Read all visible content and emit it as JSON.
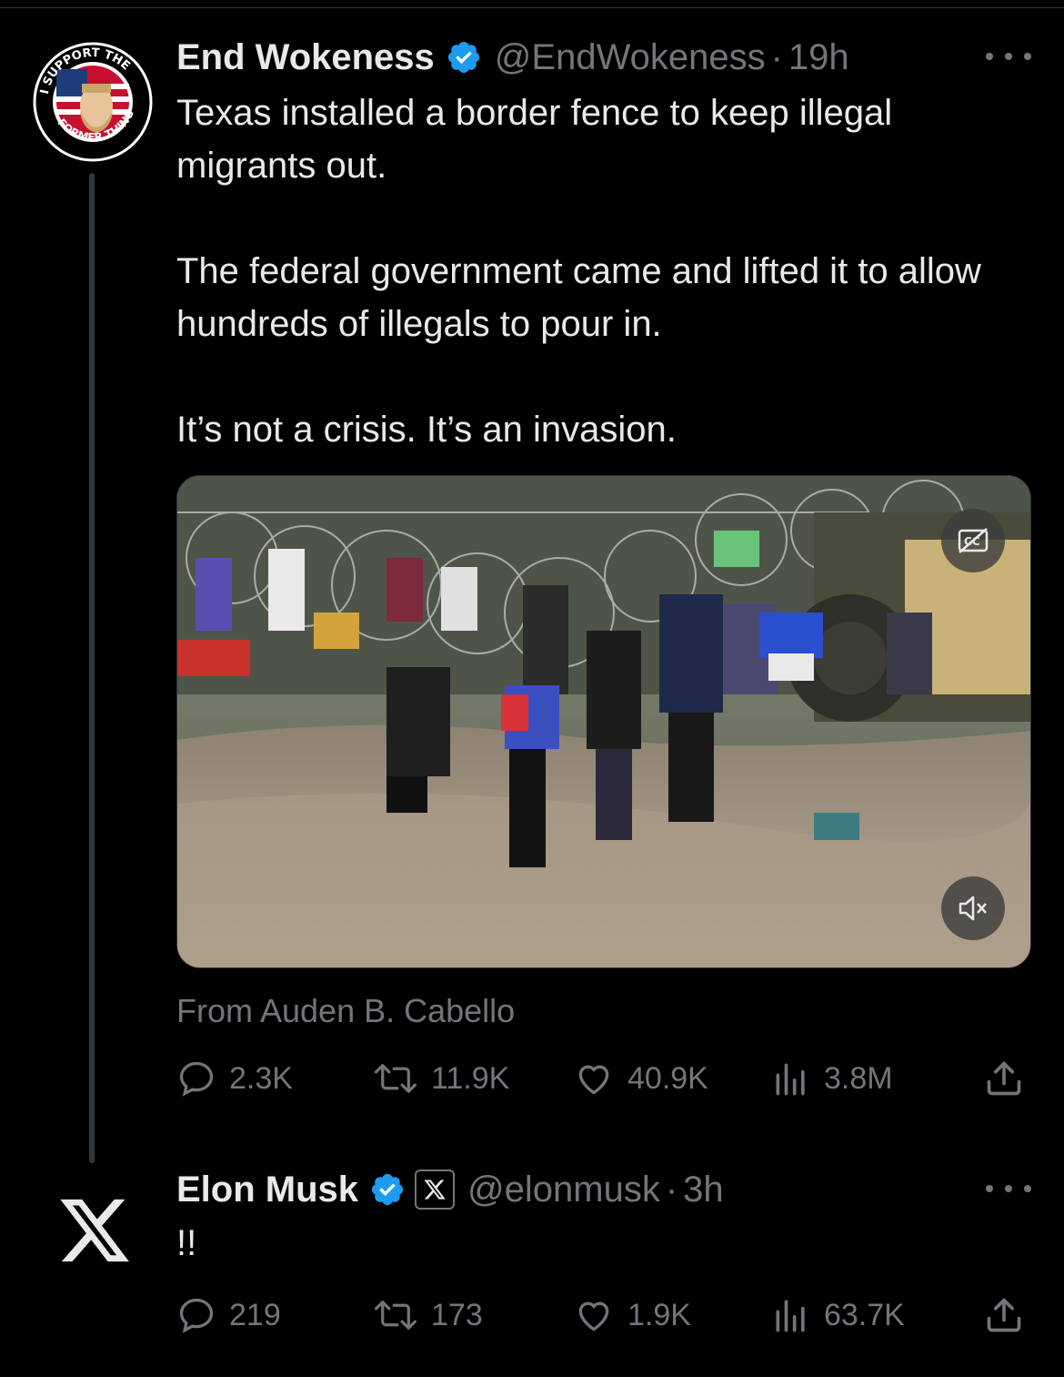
{
  "tweet1": {
    "author_name": "End Wokeness",
    "handle": "@EndWokeness",
    "separator": "·",
    "time": "19h",
    "avatar_text_top": "I SUPPORT THE",
    "avatar_text_bottom": "FORMER THINGS",
    "text_paragraphs": [
      "Texas installed a border fence to keep illegal migrants out.",
      "The federal government came and lifted it to allow hundreds of illegals to pour in.",
      "It’s not a crisis. It’s an invasion."
    ],
    "media": {
      "cc_icon": "cc-icon",
      "mute_icon": "mute-icon"
    },
    "attribution": "From Auden B. Cabello",
    "stats": {
      "replies": "2.3K",
      "reposts": "11.9K",
      "likes": "40.9K",
      "views": "3.8M"
    }
  },
  "tweet2": {
    "author_name": "Elon Musk",
    "handle": "@elonmusk",
    "separator": "·",
    "time": "3h",
    "text": "!!",
    "stats": {
      "replies": "219",
      "reposts": "173",
      "likes": "1.9K",
      "views": "63.7K"
    }
  },
  "colors": {
    "background": "#000000",
    "text": "#e7e9ea",
    "muted": "#71767b",
    "verified": "#1d9bf0",
    "thread_line": "#333639"
  }
}
